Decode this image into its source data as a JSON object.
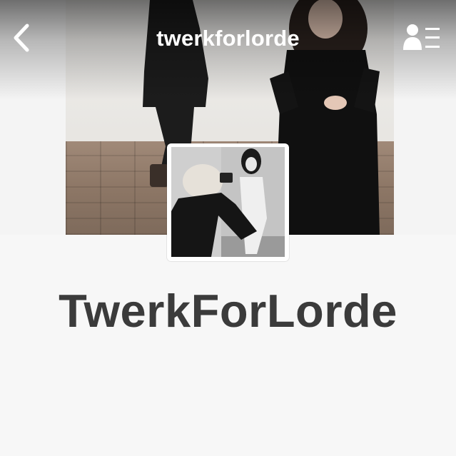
{
  "nav": {
    "title": "twerkforlorde",
    "back_icon": "chevron-left-icon",
    "menu_icon": "user-list-icon"
  },
  "blog": {
    "name": "TwerkForLorde"
  },
  "colors": {
    "page_background": "#f7f7f7",
    "title_text": "#3b3b3b",
    "nav_text": "#ffffff"
  }
}
